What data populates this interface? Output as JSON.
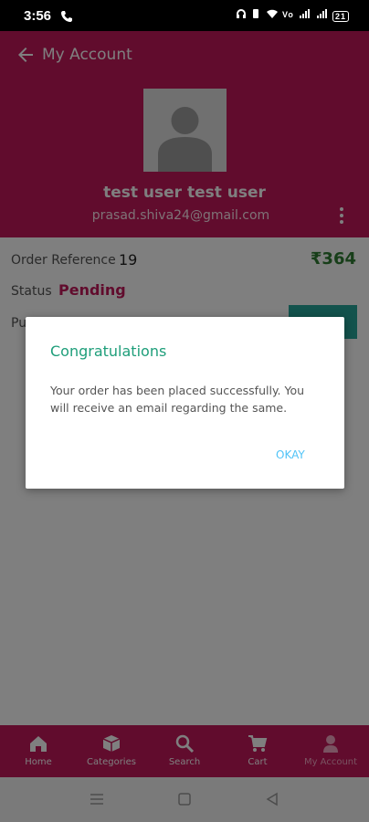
{
  "status_bar": {
    "time": "3:56",
    "battery": "21"
  },
  "header": {
    "title": "My Account",
    "user_name": "test user test user",
    "user_email": "prasad.shiva24@gmail.com"
  },
  "order": {
    "reference_label": "Order Reference",
    "reference_value": "19",
    "amount": "₹364",
    "status_label": "Status",
    "status_value": "Pending",
    "payment_label": "Pu"
  },
  "bottom_nav": [
    {
      "label": "Home",
      "icon": "home-icon"
    },
    {
      "label": "Categories",
      "icon": "categories-icon"
    },
    {
      "label": "Search",
      "icon": "search-icon"
    },
    {
      "label": "Cart",
      "icon": "cart-icon"
    },
    {
      "label": "My Account",
      "icon": "account-icon"
    }
  ],
  "dialog": {
    "title": "Congratulations",
    "message": "Your order has been placed successfully. You will receive an email regarding the same.",
    "ok_label": "OKAY"
  },
  "colors": {
    "brand": "#c2185b",
    "accent": "#1e9e7a",
    "link": "#4fc3f7",
    "amount": "#2e7d32"
  }
}
